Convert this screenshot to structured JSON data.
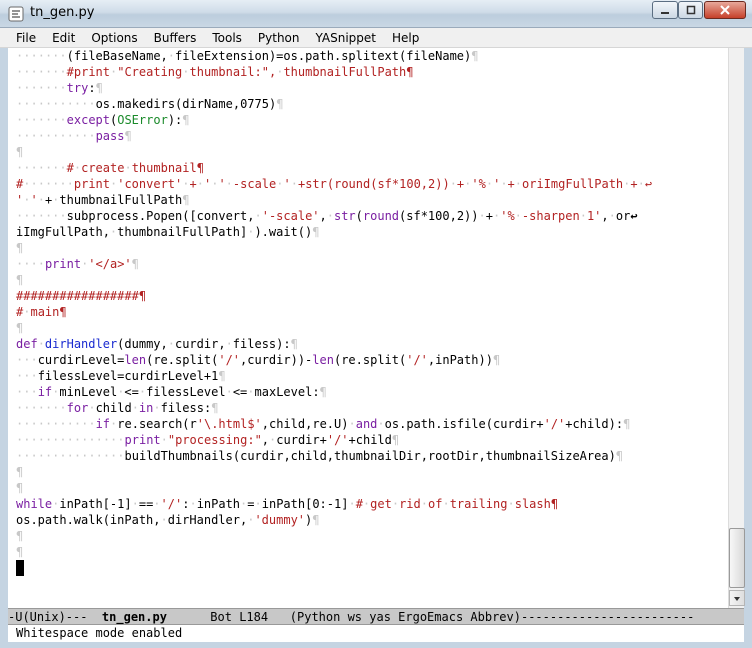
{
  "window": {
    "title": "tn_gen.py",
    "minimize_glyph": "minimize",
    "maximize_glyph": "maximize",
    "close_glyph": "close"
  },
  "menu": [
    "File",
    "Edit",
    "Options",
    "Buffers",
    "Tools",
    "Python",
    "YASnippet",
    "Help"
  ],
  "editor": {
    "lines": [
      "·······(fileBaseName,·fileExtension)=os.path.splitext(fileName)¶",
      "·······#print·\"Creating·thumbnail:\",·thumbnailFullPath¶",
      "·······try:¶",
      "···········os.makedirs(dirName,0775)¶",
      "·······except(OSError):¶",
      "···········pass¶",
      "¶",
      "·······#·create·thumbnail¶",
      "#·······print·'convert'·+·'·'·-scale·'·+str(round(sf*100,2))·+·'%·'·+·oriImgFullPath·+·↩",
      "'·'·+·thumbnailFullPath¶",
      "·······subprocess.Popen([convert,·'-scale',·str(round(sf*100,2))·+·'%·-sharpen·1',·or↩",
      "iImgFullPath,·thumbnailFullPath]·).wait()¶",
      "¶",
      "····print·'</a>'¶",
      "¶",
      "#################¶",
      "#·main¶",
      "¶",
      "def·dirHandler(dummy,·curdir,·filess):¶",
      "···curdirLevel=len(re.split('/',curdir))-len(re.split('/',inPath))¶",
      "···filessLevel=curdirLevel+1¶",
      "···if·minLevel·<=·filessLevel·<=·maxLevel:¶",
      "·······for·child·in·filess:¶",
      "···········if·re.search(r'\\.html$',child,re.U)·and·os.path.isfile(curdir+'/'+child):¶",
      "···············print·\"processing:\",·curdir+'/'+child¶",
      "···············buildThumbnails(curdir,child,thumbnailDir,rootDir,thumbnailSizeArea)¶",
      "¶",
      "¶",
      "while·inPath[-1]·==·'/':·inPath·=·inPath[0:-1]·#·get·rid·of·trailing·slash¶",
      "os.path.walk(inPath,·dirHandler,·'dummy')¶",
      "¶",
      "¶"
    ]
  },
  "modeline": {
    "prefix": "-U(Unix)---  ",
    "buffer_name": "tn_gen.py",
    "position": "      Bot L184   ",
    "modes": "(Python ws yas ErgoEmacs Abbrev)",
    "fill": "------------------------"
  },
  "minibuffer": {
    "message": "Whitespace mode enabled"
  },
  "colors": {
    "keyword": "#7a1fa2",
    "string": "#b22222",
    "comment": "#b22222",
    "function": "#1a2bd0",
    "whitespace_mark": "#c8c8c8"
  }
}
